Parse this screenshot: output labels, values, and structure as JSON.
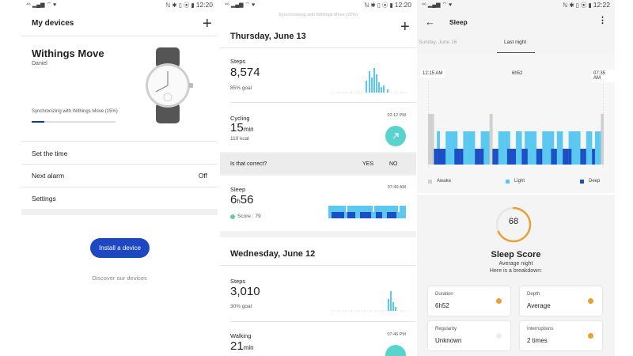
{
  "statusbar": {
    "left_glyphs": "⁴⁶ ▂▄▆ ⌔ ♥",
    "right_glyphs": "ℕ ✱ ▯ ⦿ ▮",
    "time_1": "12:20",
    "time_2": "12:20",
    "time_3": "12:22"
  },
  "devices": {
    "title": "My devices",
    "add_icon": "plus-icon",
    "device_name": "Withings Move",
    "device_user": "Daniel",
    "sync_text": "Synchronizing with Withings Move (15%)",
    "sync_progress": 0.15,
    "menu": [
      {
        "label": "Set the time",
        "value": ""
      },
      {
        "label": "Next alarm",
        "value": "Off"
      },
      {
        "label": "Settings",
        "value": ""
      }
    ],
    "install_button": "Install a device",
    "discover_link": "Discover our devices"
  },
  "timeline": {
    "sync_banner": "Synchronizing with Withings Move (22%)",
    "day1": {
      "date": "Thursday, June 13",
      "steps_label": "Steps",
      "steps_value": "8,574",
      "steps_sub": "85% goal",
      "cycling_label": "Cycling",
      "cycling_value": "15",
      "cycling_unit": "min",
      "cycling_sub": "110 kcal",
      "cycling_time": "02:12 PM",
      "question": "Is that correct?",
      "yes": "YES",
      "no": "NO",
      "sleep_label": "Sleep",
      "sleep_h": "6",
      "sleep_h_unit": "h",
      "sleep_m": "56",
      "sleep_score": "Score : 79",
      "sleep_time": "07:49 AM"
    },
    "day2": {
      "date": "Wednesday, June 12",
      "steps_label": "Steps",
      "steps_value": "3,010",
      "steps_sub": "30% goal",
      "walking_label": "Walking",
      "walking_value": "21",
      "walking_unit": "min",
      "walking_time": "07:46 PM"
    }
  },
  "sleep": {
    "title": "Sleep",
    "tab_prev": "Sunday, June 16",
    "tab_active": "Last night",
    "start_time": "12:15 AM",
    "duration_label": "6h52",
    "end_time": "07:35 AM",
    "legend": [
      "Awake",
      "Light",
      "Deep"
    ],
    "colors": {
      "awake": "#d0d0d0",
      "light": "#5bc8f0",
      "deep": "#1d4fc4",
      "accent": "#e8a13a"
    },
    "score": "68",
    "score_fraction": 0.68,
    "score_title": "Sleep Score",
    "score_sub1": "Average night",
    "score_sub2": "Here is a breakdown:",
    "tiles": [
      {
        "label": "Duration",
        "value": "6h52",
        "dot": "#e8a13a"
      },
      {
        "label": "Depth",
        "value": "Average",
        "dot": "#e8a13a"
      },
      {
        "label": "Regularity",
        "value": "Unknown",
        "dot": "#ececec"
      },
      {
        "label": "Interruptions",
        "value": "2 times",
        "dot": "#e8a13a"
      }
    ]
  }
}
